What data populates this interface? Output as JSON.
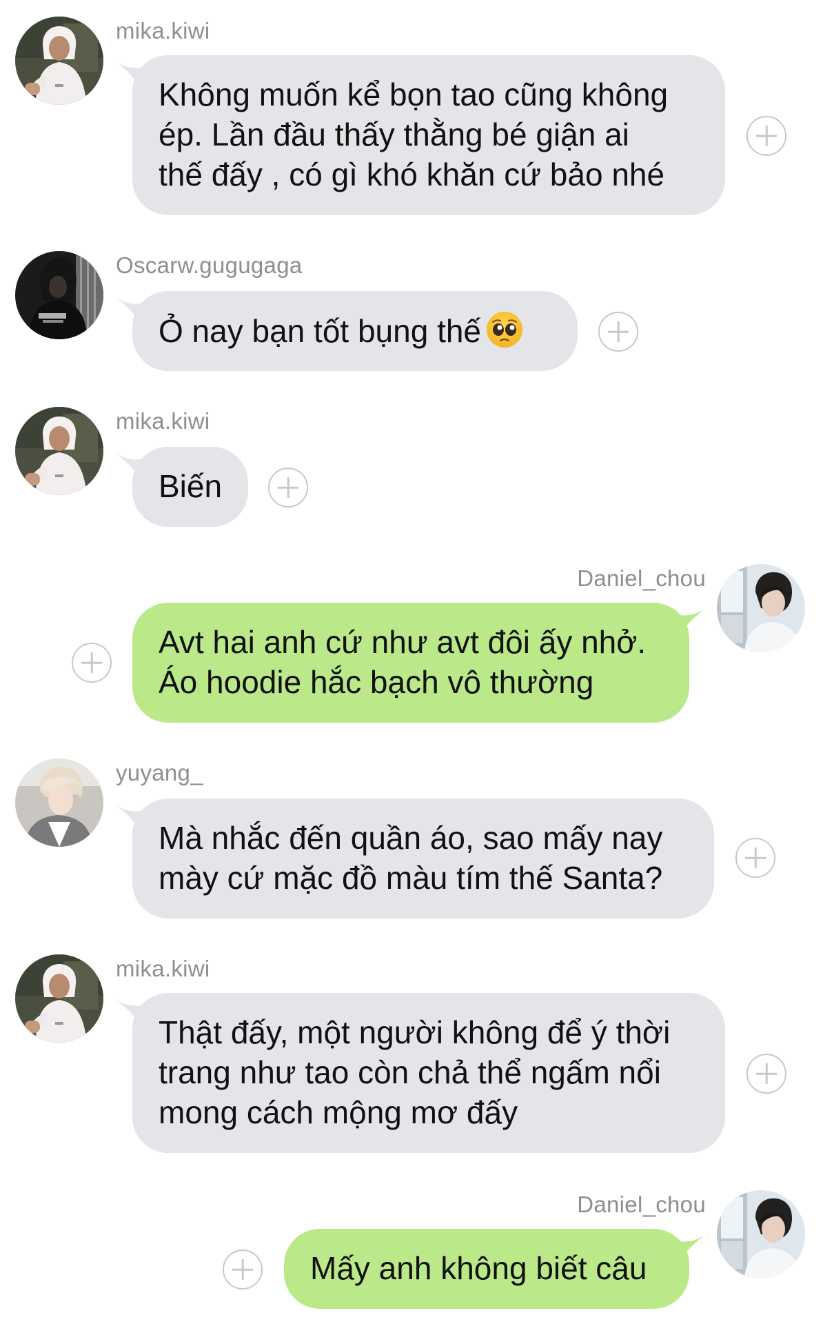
{
  "messages": [
    {
      "sender": "mika.kiwi",
      "text": "Không muốn kể bọn tao cũng không\nép. Lần đầu thấy thằng bé giận ai\nthế đấy , có gì khó khăn cứ bảo nhé",
      "direction": "incoming"
    },
    {
      "sender": "Oscarw.gugugaga",
      "text": "Ỏ nay bạn tốt bụng thế",
      "emoji": "pleading-face",
      "direction": "incoming"
    },
    {
      "sender": "mika.kiwi",
      "text": "Biến",
      "direction": "incoming"
    },
    {
      "sender": "Daniel_chou",
      "text": "Avt hai anh cứ như avt đôi ấy nhở.\nÁo hoodie hắc bạch vô thường",
      "direction": "outgoing"
    },
    {
      "sender": "yuyang_",
      "text": "Mà nhắc đến quần áo, sao mấy nay\nmày cứ mặc đồ màu tím thế Santa?",
      "direction": "incoming"
    },
    {
      "sender": "mika.kiwi",
      "text": "Thật đấy, một người không để ý thời\ntrang như tao còn chả thể ngấm nổi\nmong cách mộng mơ đấy",
      "direction": "incoming"
    },
    {
      "sender": "Daniel_chou",
      "text": "Mấy anh không biết câu",
      "direction": "outgoing"
    }
  ],
  "colors": {
    "incoming_bubble": "#e3e5e9",
    "outgoing_bubble": "#bbe98a",
    "sender_name": "#8e8e93",
    "plus_icon": "#c8c8cc"
  },
  "icons": {
    "add_reaction": "plus-circle-icon"
  }
}
